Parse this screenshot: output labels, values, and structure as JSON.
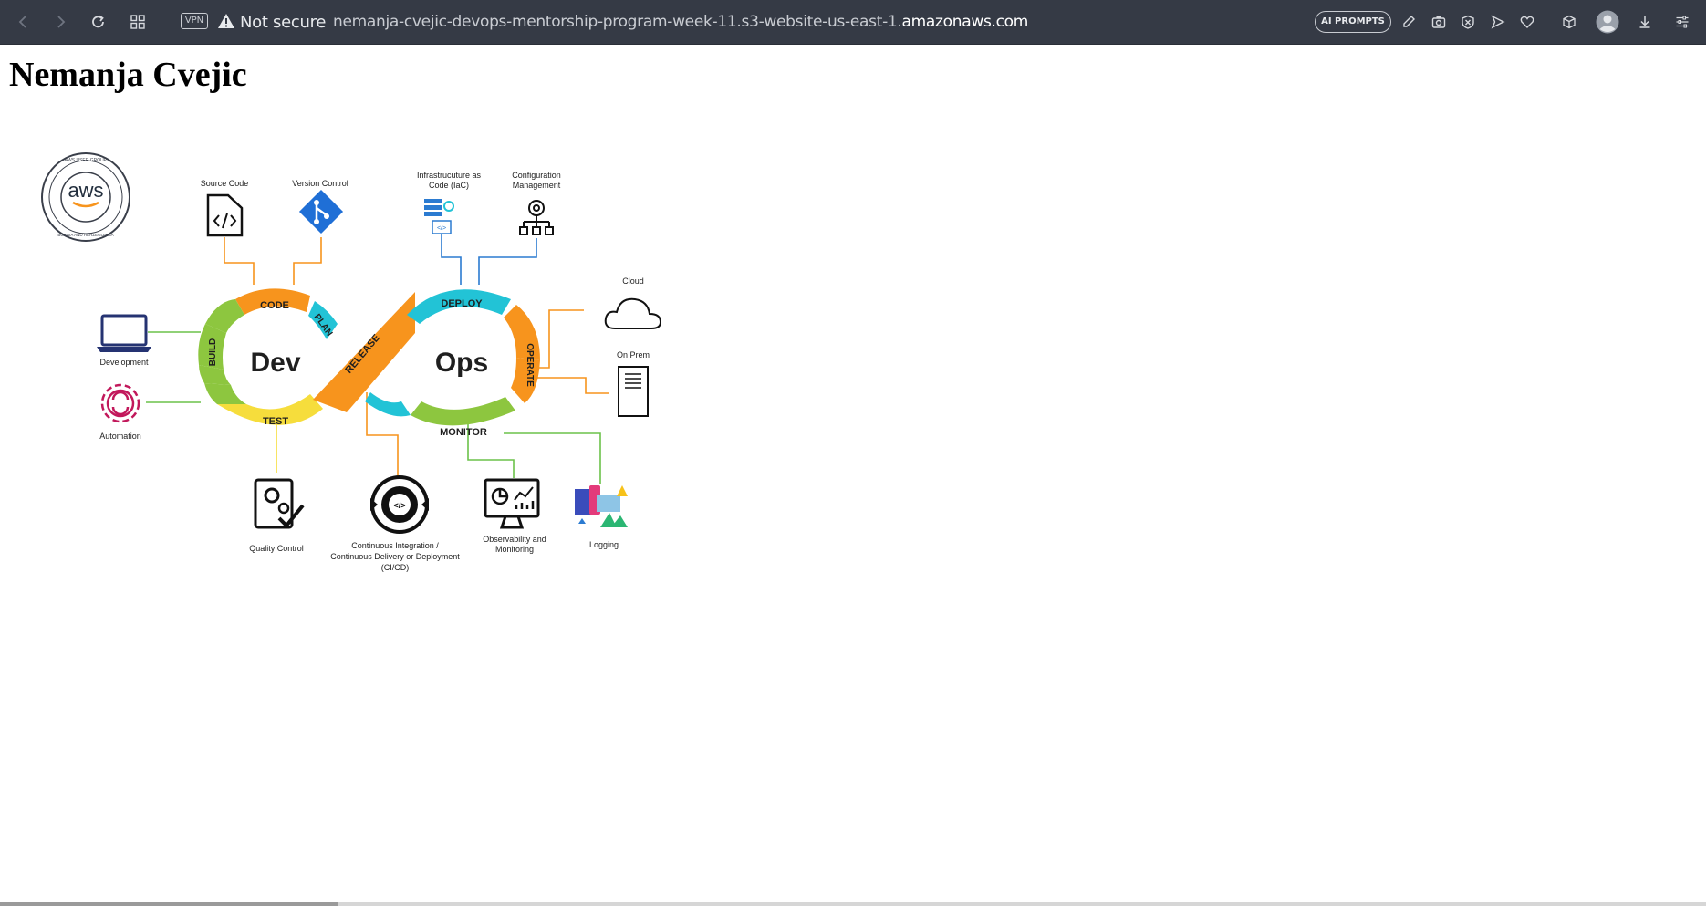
{
  "browser": {
    "vpn_label": "VPN",
    "security_label": "Not secure",
    "url_subdomain": "nemanja-cvejic-devops-mentorship-program-week-11.s3-website-us-east-1.",
    "url_domain": "amazonaws.com",
    "ai_prompts_label": "AI PROMPTS"
  },
  "page": {
    "title": "Nemanja Cvejic"
  },
  "diagram": {
    "center_left": "Dev",
    "center_right": "Ops",
    "phases": {
      "code": "CODE",
      "plan": "PLAN",
      "build": "BUILD",
      "test": "TEST",
      "release": "RELEASE",
      "deploy": "DEPLOY",
      "operate": "OPERATE",
      "monitor": "MONITOR"
    },
    "labels": {
      "source_code": "Source Code",
      "version_control": "Version Control",
      "iac_line1": "Infrastrucuture as",
      "iac_line2": "Code (IaC)",
      "config_line1": "Configuration",
      "config_line2": "Management",
      "cloud": "Cloud",
      "on_prem": "On Prem",
      "development": "Development",
      "automation": "Automation",
      "quality_control": "Quality Control",
      "cicd_line1": "Continuous Integration /",
      "cicd_line2": "Continuous Delivery or Deployment",
      "cicd_line3": "(CI/CD)",
      "observability_line1": "Observability and",
      "observability_line2": "Monitoring",
      "logging": "Logging"
    },
    "badge": {
      "logo_text": "aws",
      "ring_top": "AWS USER GROUP",
      "ring_bottom": "BOSNIA AND HERZEGOVINA"
    }
  },
  "colors": {
    "toolbar_bg": "#353a45",
    "orange": "#f7941d",
    "teal": "#22c3d6",
    "green": "#8dc63f",
    "yellow": "#f6dd3c",
    "blue_line": "#2b7bd1",
    "green_line": "#6cc24a"
  }
}
